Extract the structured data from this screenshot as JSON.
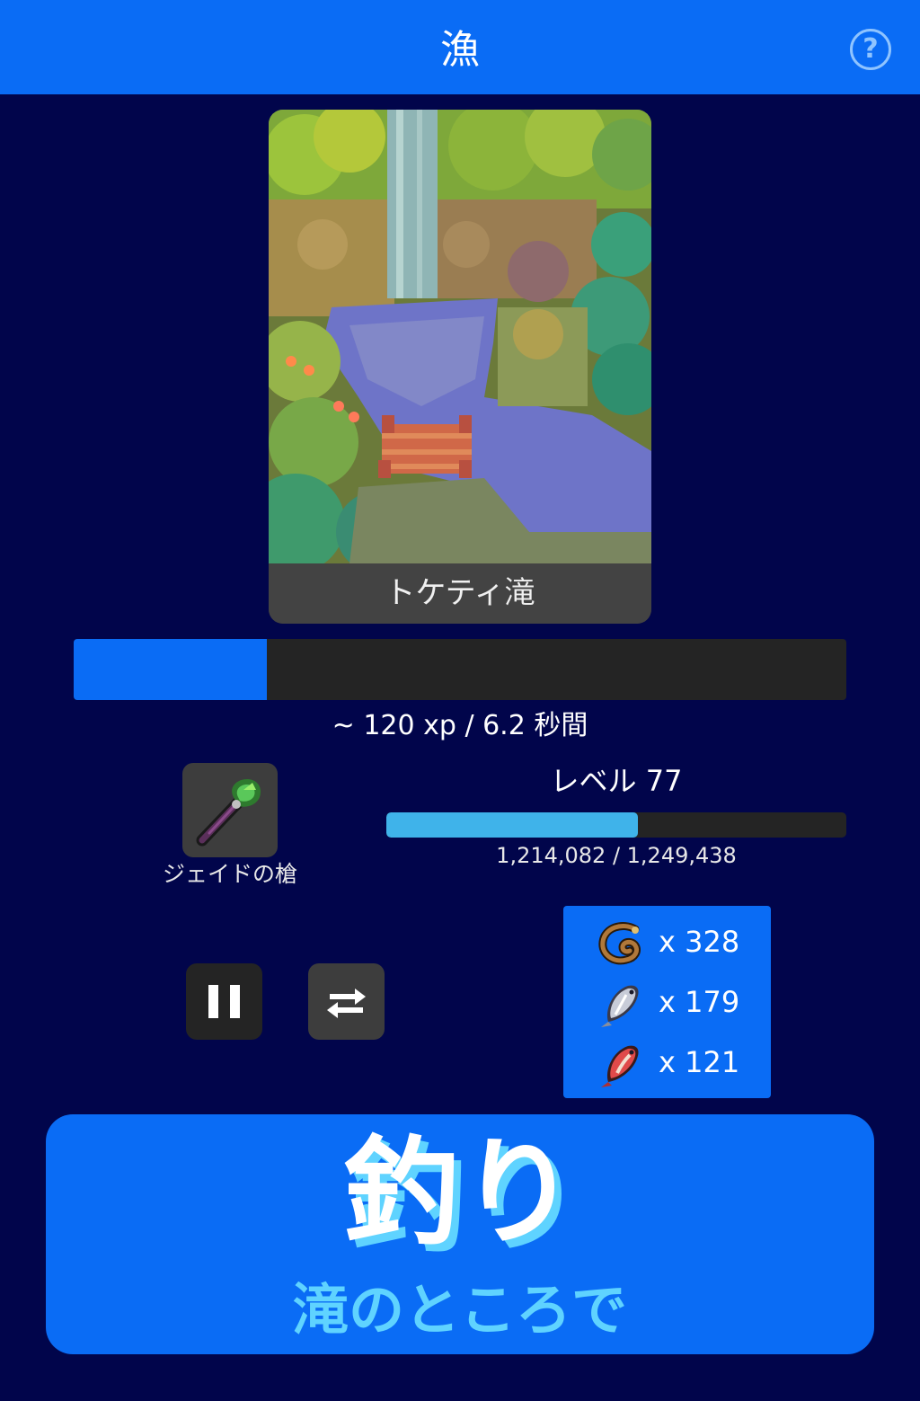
{
  "header": {
    "title": "漁",
    "help_symbol": "?",
    "help_icon": "question-circle-icon"
  },
  "location": {
    "name": "トケティ滝",
    "image": "waterfall-pixel-art-scene"
  },
  "action": {
    "progress": 0.25,
    "rate_text": "~ 120 xp / 6.2 秒間"
  },
  "tool": {
    "name": "ジェイドの槍",
    "icon": "jade-spear-icon"
  },
  "skill": {
    "level_text": "レベル 77",
    "xp_text": "1,214,082 / 1,249,438",
    "xp_current": 1214082,
    "xp_next": 1249438
  },
  "controls": {
    "pause_icon": "pause-icon",
    "swap_icon": "swap-arrows-icon"
  },
  "loot": [
    {
      "icon": "eel-icon",
      "count": "x 328"
    },
    {
      "icon": "silver-fish-icon",
      "count": "x 179"
    },
    {
      "icon": "red-fish-icon",
      "count": "x 121"
    }
  ],
  "fish_button": {
    "label": "釣り",
    "sublabel": "滝のところで"
  },
  "colors": {
    "accent": "#0a6cf5",
    "background": "#01054b",
    "xp_bar": "#3fb3ea",
    "highlight": "#5fd3ff"
  }
}
